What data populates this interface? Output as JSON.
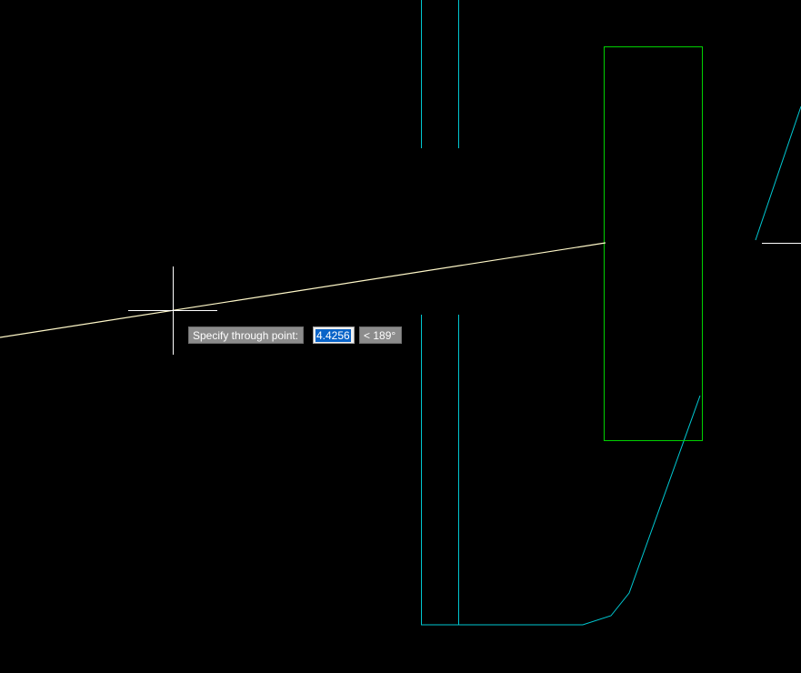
{
  "prompt": {
    "label": "Specify through point:",
    "distance_value": "4.4256",
    "angle_value": "< 189°"
  },
  "colors": {
    "background": "#000000",
    "cyan_geometry": "#00c8d2",
    "green_geometry": "#00d000",
    "rubberband_line": "#fff8c8",
    "crosshair": "#ffffff"
  },
  "icons": {
    "cursor": "crosshair-cursor-icon"
  }
}
